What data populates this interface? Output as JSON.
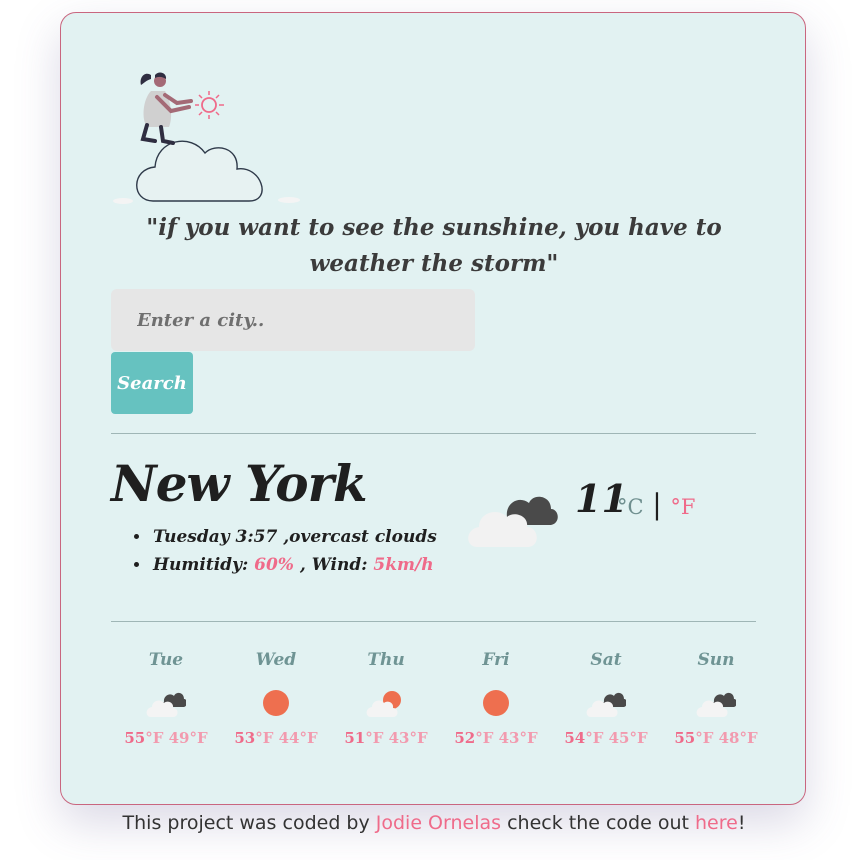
{
  "quote": "\"if you want to see the sunshine, you have to weather the storm\"",
  "search": {
    "placeholder": "Enter a city..",
    "button_label": "Search"
  },
  "current": {
    "city": "New York",
    "datetime_description": "Tuesday 3:57 ,overcast clouds",
    "humidity_label": "Humitidy: ",
    "humidity_value": "60%",
    "wind_label": " , Wind: ",
    "wind_value": "5km/h",
    "temperature": "11",
    "unit_c": "°C",
    "unit_sep": "|",
    "unit_f": "°F",
    "icon": "broken-clouds-icon"
  },
  "forecast": [
    {
      "day": "Tue",
      "max": "55",
      "min": "49",
      "unit": "°F",
      "icon": "broken-clouds"
    },
    {
      "day": "Wed",
      "max": "53",
      "min": "44",
      "unit": "°F",
      "icon": "clear-sun"
    },
    {
      "day": "Thu",
      "max": "51",
      "min": "43",
      "unit": "°F",
      "icon": "few-clouds"
    },
    {
      "day": "Fri",
      "max": "52",
      "min": "43",
      "unit": "°F",
      "icon": "clear-sun"
    },
    {
      "day": "Sat",
      "max": "54",
      "min": "45",
      "unit": "°F",
      "icon": "broken-clouds"
    },
    {
      "day": "Sun",
      "max": "55",
      "min": "48",
      "unit": "°F",
      "icon": "broken-clouds"
    }
  ],
  "footer": {
    "prefix": "This project was coded by ",
    "author": "Jodie Ornelas",
    "middle": " check the code out ",
    "link": "here",
    "suffix": "!"
  },
  "colors": {
    "card_bg": "#e2f2f2",
    "accent_pink": "#ef6b8a",
    "button_teal": "#66c2c0",
    "sun_orange": "#ee6f4f"
  }
}
